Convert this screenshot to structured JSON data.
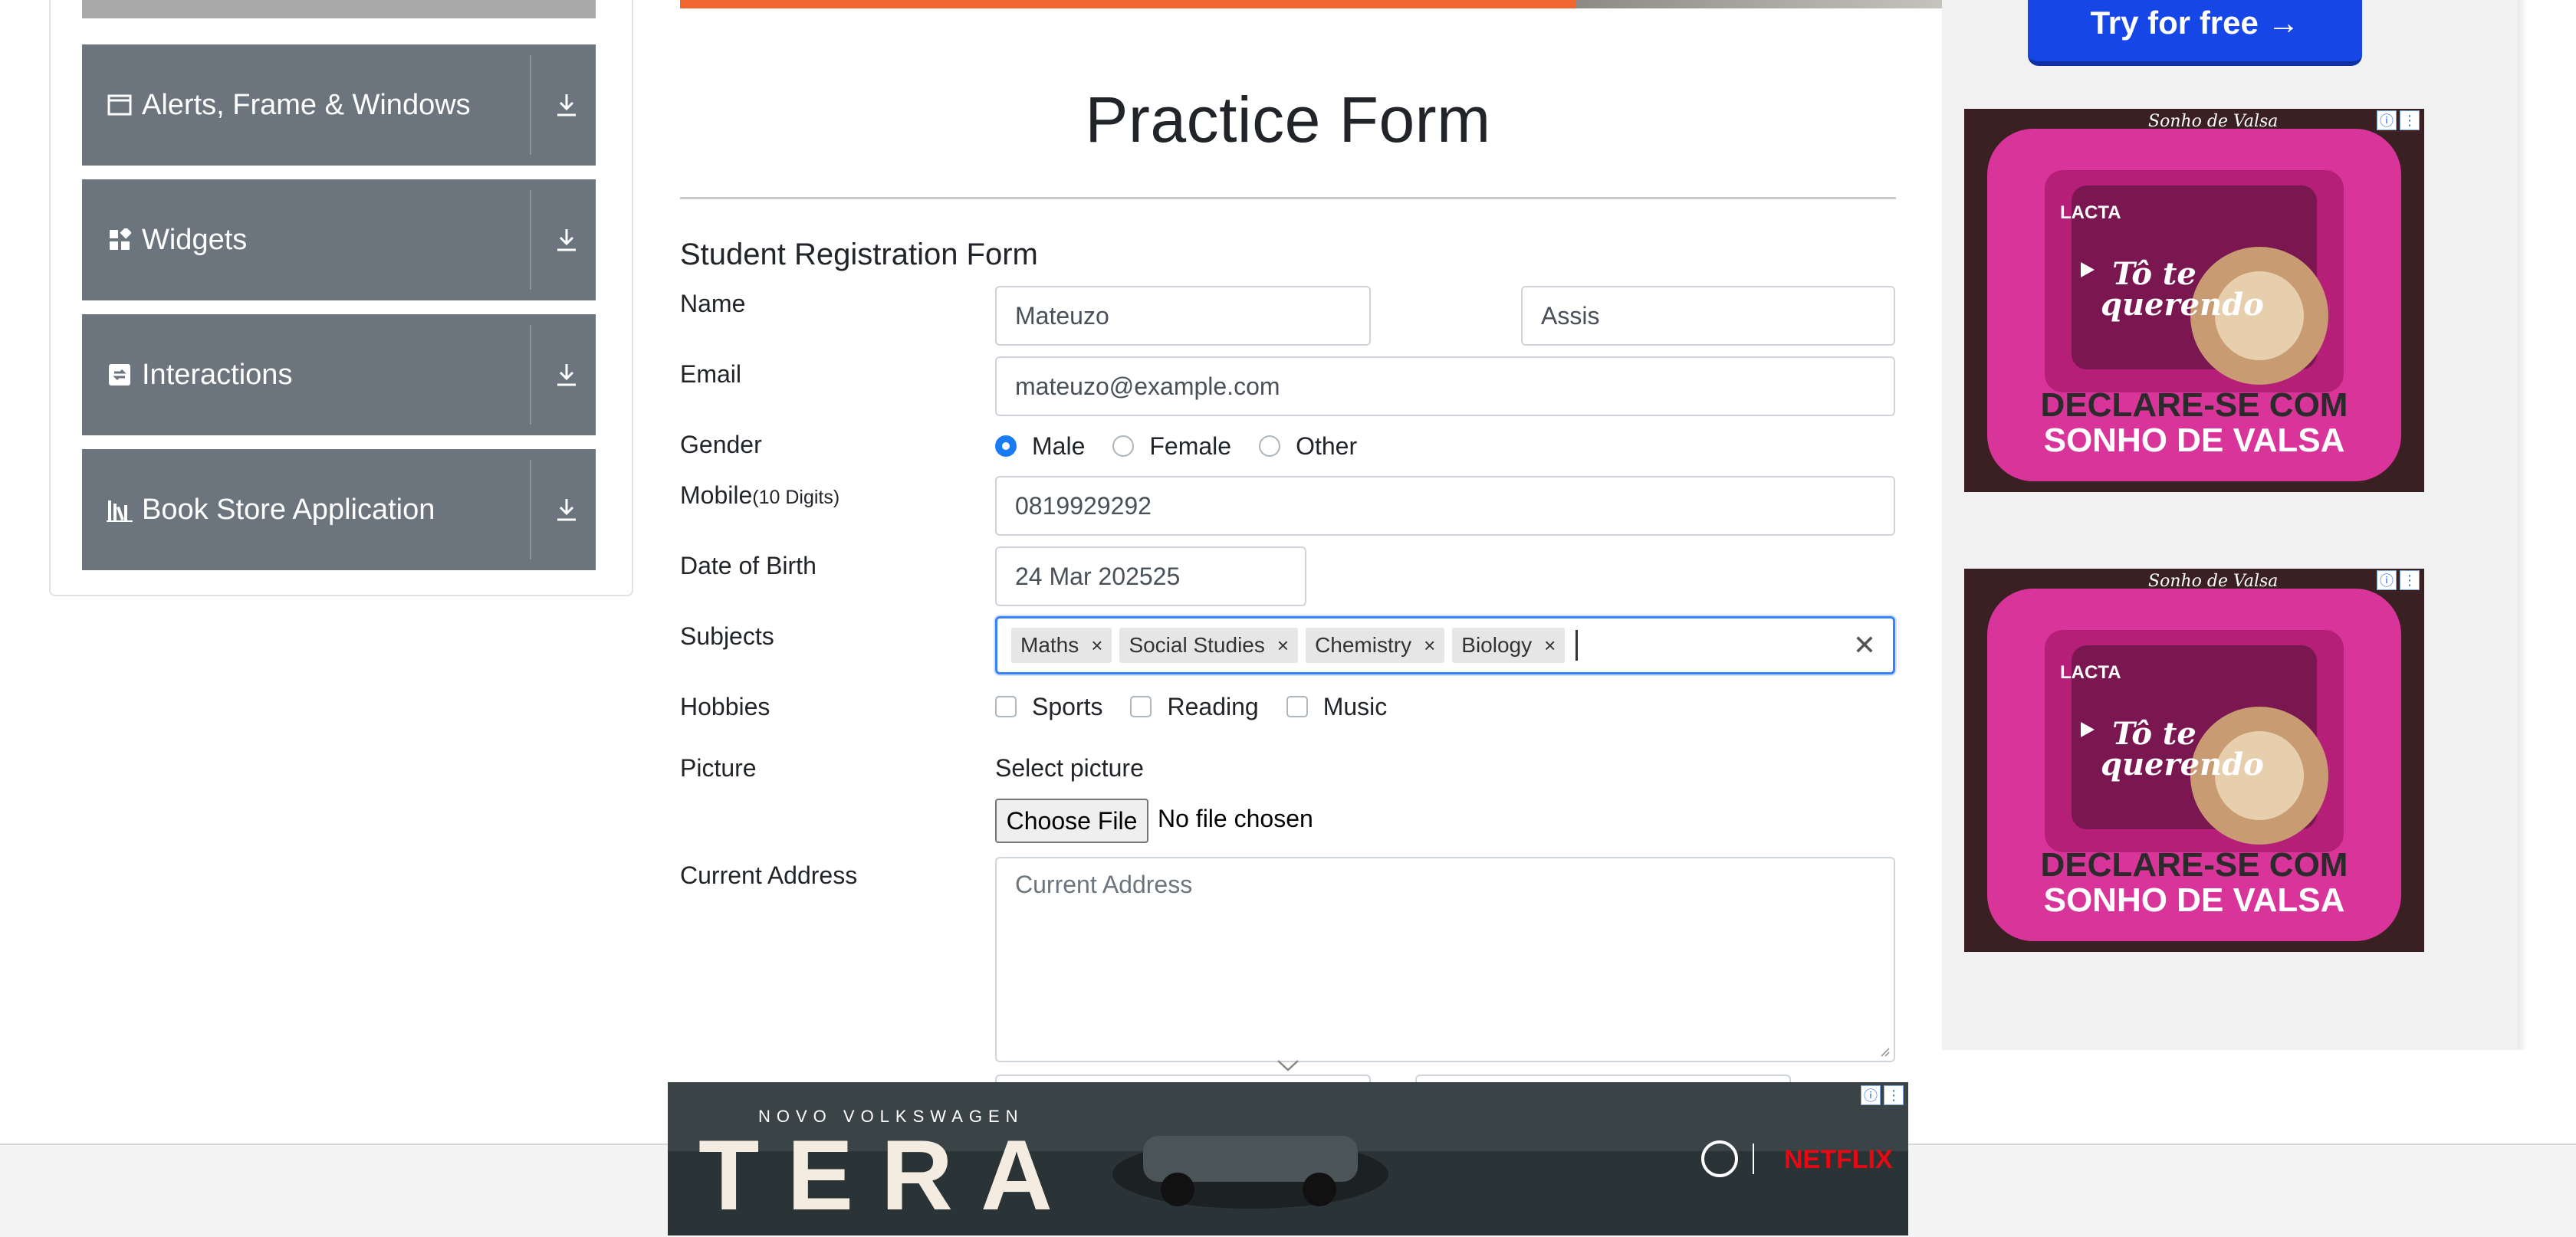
{
  "sidebar": {
    "items": [
      {
        "label": "Alerts, Frame & Windows",
        "icon": "window-icon"
      },
      {
        "label": "Widgets",
        "icon": "widgets-icon"
      },
      {
        "label": "Interactions",
        "icon": "interactions-icon"
      },
      {
        "label": "Book Store Application",
        "icon": "bookstore-icon"
      }
    ]
  },
  "form": {
    "title": "Practice Form",
    "heading": "Student Registration Form",
    "name": {
      "label": "Name",
      "first": "Mateuzo",
      "last": "Assis"
    },
    "email": {
      "label": "Email",
      "value": "mateuzo@example.com"
    },
    "gender": {
      "label": "Gender",
      "options": [
        "Male",
        "Female",
        "Other"
      ],
      "selected": "Male"
    },
    "mobile": {
      "label": "Mobile",
      "hint": "(10 Digits)",
      "value": "0819929292"
    },
    "dob": {
      "label": "Date of Birth",
      "value": "24 Mar 202525"
    },
    "subjects": {
      "label": "Subjects",
      "chips": [
        "Maths",
        "Social Studies",
        "Chemistry",
        "Biology"
      ],
      "remove_glyph": "×",
      "clear_glyph": "✕"
    },
    "hobbies": {
      "label": "Hobbies",
      "options": [
        "Sports",
        "Reading",
        "Music"
      ]
    },
    "picture": {
      "label": "Picture",
      "select_text": "Select picture",
      "button": "Choose File",
      "status": "No file chosen"
    },
    "address": {
      "label": "Current Address",
      "placeholder": "Current Address"
    }
  },
  "ads": {
    "try_button": "Try for free →",
    "chocolate_ad": {
      "brand": "Sonho de Valsa",
      "maker": "LACTA",
      "slogan": "Tô te querendo",
      "headline_line1": "DECLARE-SE COM",
      "headline_line2": "SONHO DE VALSA"
    },
    "bottom_ad": {
      "kicker": "NOVO VOLKSWAGEN",
      "model": "TERA",
      "partner": "NETFLIX"
    }
  },
  "colors": {
    "sidebar_bg": "#6c757d",
    "accent_blue": "#1a7cf5",
    "ad_pink": "#d9349a",
    "netflix_red": "#e50914"
  }
}
